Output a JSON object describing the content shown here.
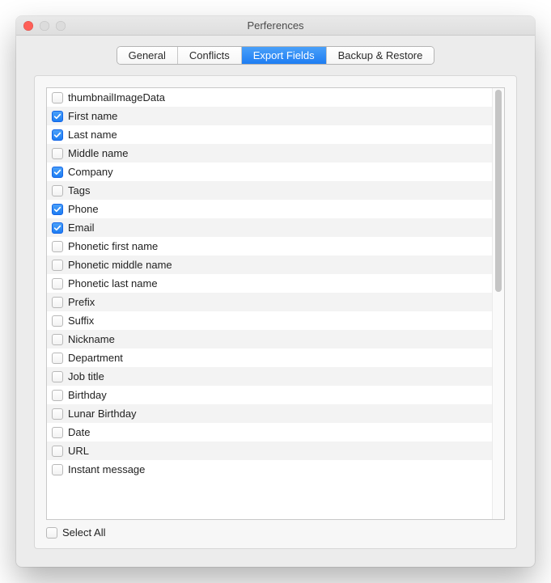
{
  "window": {
    "title": "Perferences"
  },
  "tabs": [
    {
      "label": "General",
      "active": false
    },
    {
      "label": "Conflicts",
      "active": false
    },
    {
      "label": "Export Fields",
      "active": true
    },
    {
      "label": "Backup & Restore",
      "active": false
    }
  ],
  "fields": [
    {
      "label": "thumbnailImageData",
      "checked": false
    },
    {
      "label": "First name",
      "checked": true
    },
    {
      "label": "Last name",
      "checked": true
    },
    {
      "label": "Middle name",
      "checked": false
    },
    {
      "label": "Company",
      "checked": true
    },
    {
      "label": "Tags",
      "checked": false
    },
    {
      "label": "Phone",
      "checked": true
    },
    {
      "label": "Email",
      "checked": true
    },
    {
      "label": "Phonetic first name",
      "checked": false
    },
    {
      "label": "Phonetic middle name",
      "checked": false
    },
    {
      "label": "Phonetic last name",
      "checked": false
    },
    {
      "label": "Prefix",
      "checked": false
    },
    {
      "label": "Suffix",
      "checked": false
    },
    {
      "label": "Nickname",
      "checked": false
    },
    {
      "label": "Department",
      "checked": false
    },
    {
      "label": "Job title",
      "checked": false
    },
    {
      "label": "Birthday",
      "checked": false
    },
    {
      "label": "Lunar Birthday",
      "checked": false
    },
    {
      "label": "Date",
      "checked": false
    },
    {
      "label": "URL",
      "checked": false
    },
    {
      "label": "Instant message",
      "checked": false
    }
  ],
  "selectAll": {
    "label": "Select All",
    "checked": false
  }
}
